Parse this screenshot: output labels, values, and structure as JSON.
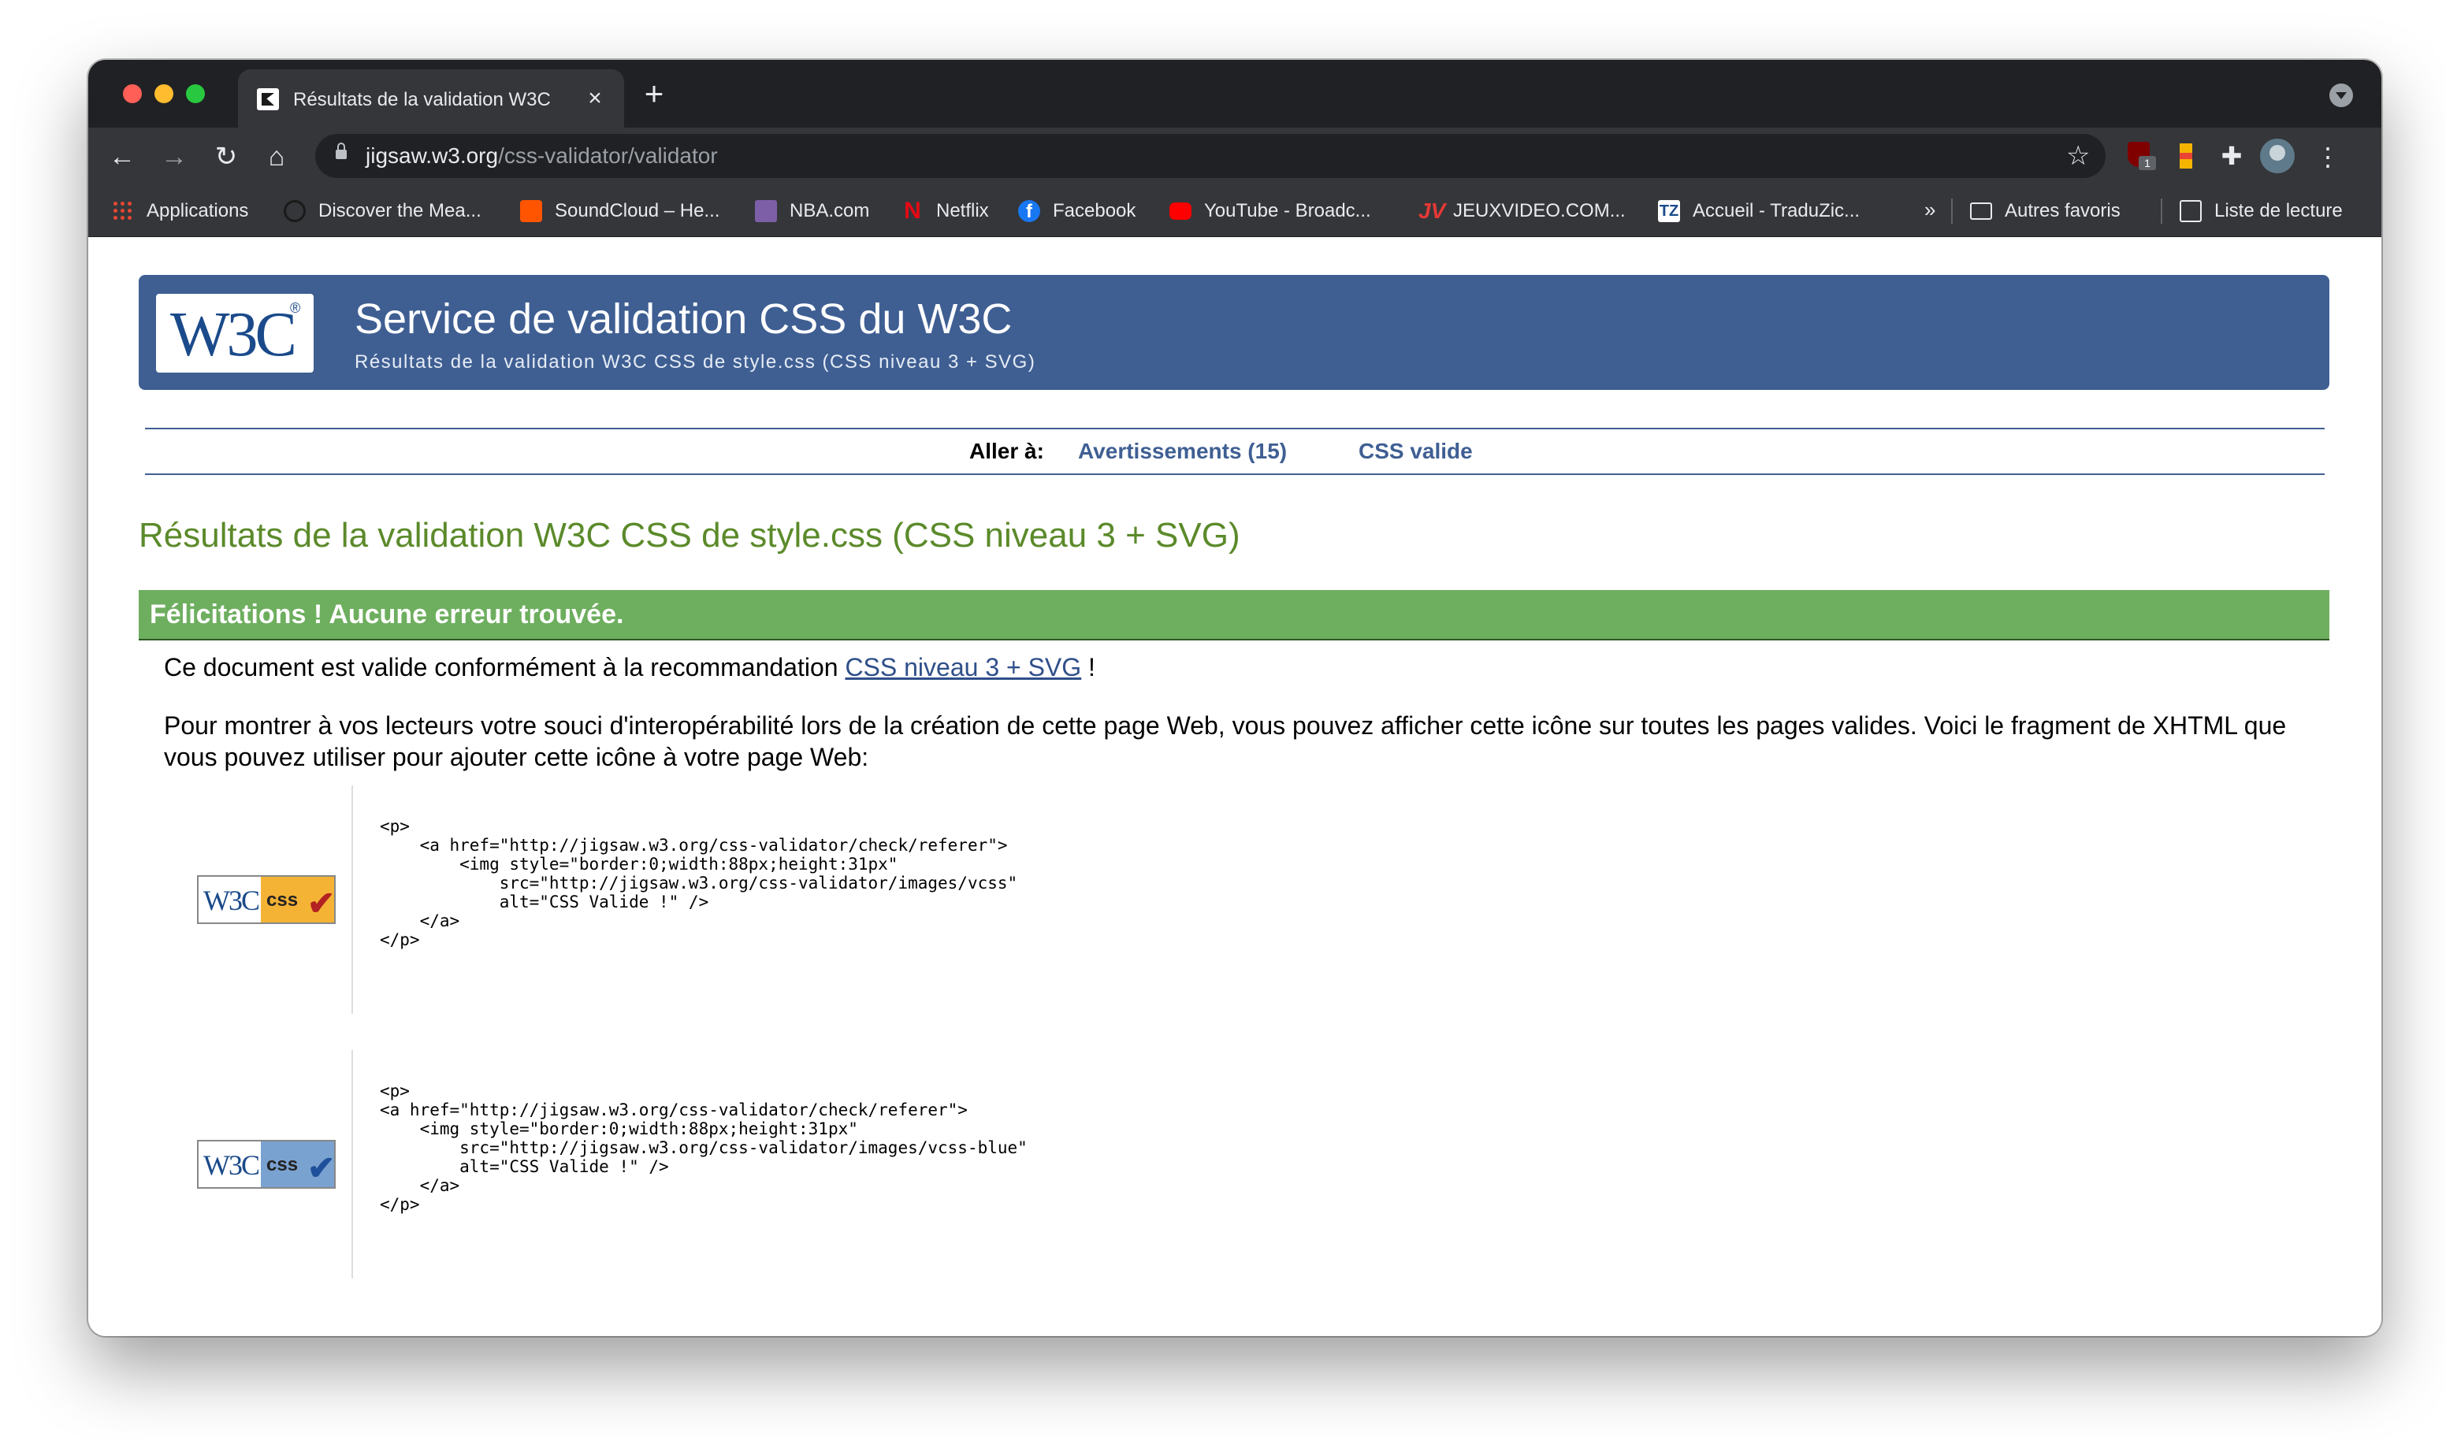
{
  "browser": {
    "tab": {
      "title": "Résultats de la validation W3C"
    },
    "url": {
      "host": "jigsaw.w3.org",
      "path": "/css-validator/validator"
    },
    "bookmarks": [
      {
        "label": "Applications",
        "icon": "apps-grid-icon"
      },
      {
        "label": "Discover the Mea...",
        "icon": "site-icon"
      },
      {
        "label": "SoundCloud – He...",
        "icon": "soundcloud-icon"
      },
      {
        "label": "NBA.com",
        "icon": "nba-icon"
      },
      {
        "label": "Netflix",
        "icon": "netflix-icon"
      },
      {
        "label": "Facebook",
        "icon": "facebook-icon"
      },
      {
        "label": "YouTube - Broadc...",
        "icon": "youtube-icon"
      },
      {
        "label": "JEUXVIDEO.COM...",
        "icon": "jeuxvideo-icon"
      },
      {
        "label": "Accueil - TraduZic...",
        "icon": "traduzic-icon"
      }
    ],
    "bookmarks_more": "»",
    "other_bookmarks": "Autres favoris",
    "reading_list": "Liste de lecture",
    "extension_badge": "1"
  },
  "page": {
    "logo_text": "W3C",
    "logo_mark": "®",
    "banner_title": "Service de validation CSS du W3C",
    "banner_subtitle": "Résultats de la validation W3C CSS de style.css (CSS niveau 3 + SVG)",
    "jump": {
      "label": "Aller à:",
      "links": [
        "Avertissements (15)",
        "CSS valide"
      ]
    },
    "results_title": "Résultats de la validation W3C CSS de style.css (CSS niveau 3 + SVG)",
    "congrats": "Félicitations ! Aucune erreur trouvée.",
    "valid_text_before": "Ce document est valide conformément à la recommandation ",
    "valid_link": "CSS niveau 3 + SVG",
    "valid_text_after": " !",
    "info_text": "Pour montrer à vos lecteurs votre souci d'interopérabilité lors de la création de cette page Web, vous pouvez afficher cette icône sur toutes les pages valides. Voici le fragment de XHTML que vous pouvez utiliser pour ajouter cette icône à votre page Web:",
    "badge": {
      "w3c": "W3C",
      "css": "css"
    },
    "snippets": [
      {
        "variant": "vcss",
        "code": "<p>\n    <a href=\"http://jigsaw.w3.org/css-validator/check/referer\">\n        <img style=\"border:0;width:88px;height:31px\"\n            src=\"http://jigsaw.w3.org/css-validator/images/vcss\"\n            alt=\"CSS Valide !\" />\n    </a>\n</p>"
      },
      {
        "variant": "vcss-blue",
        "code": "<p>\n<a href=\"http://jigsaw.w3.org/css-validator/check/referer\">\n    <img style=\"border:0;width:88px;height:31px\"\n        src=\"http://jigsaw.w3.org/css-validator/images/vcss-blue\"\n        alt=\"CSS Valide !\" />\n    </a>\n</p>"
      }
    ]
  },
  "colors": {
    "banner": "#3f5f93",
    "congrats": "#6eae5f",
    "results_title": "#5b8a2a",
    "link": "#3f5f93"
  }
}
